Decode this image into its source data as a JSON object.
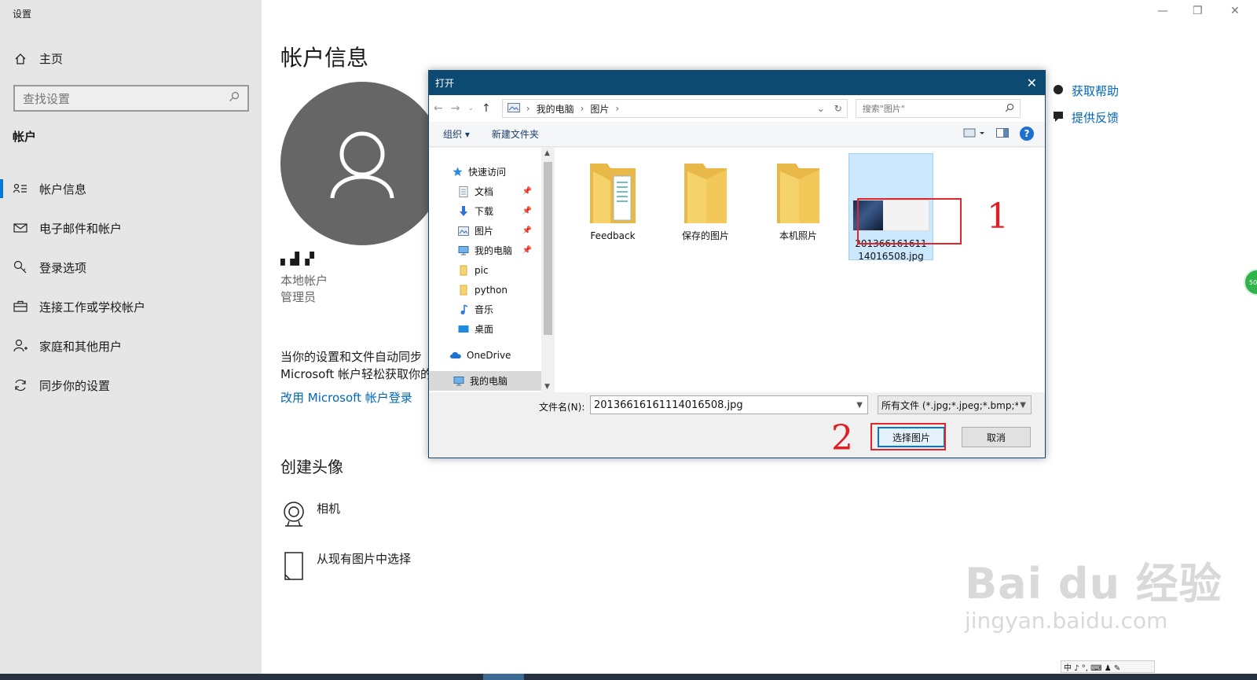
{
  "app": {
    "title": "设置",
    "window_controls": {
      "minimize": "—",
      "maximize": "❐",
      "close": "✕"
    }
  },
  "sidebar": {
    "home_label": "主页",
    "search_placeholder": "查找设置",
    "section_title": "帐户",
    "items": [
      {
        "label": "帐户信息",
        "icon": "account-info-icon",
        "active": true
      },
      {
        "label": "电子邮件和帐户",
        "icon": "mail-icon",
        "active": false
      },
      {
        "label": "登录选项",
        "icon": "key-icon",
        "active": false
      },
      {
        "label": "连接工作或学校帐户",
        "icon": "briefcase-icon",
        "active": false
      },
      {
        "label": "家庭和其他用户",
        "icon": "person-add-icon",
        "active": false
      },
      {
        "label": "同步你的设置",
        "icon": "sync-icon",
        "active": false
      }
    ]
  },
  "main": {
    "title": "帐户信息",
    "user_name": "▖▟ ▞",
    "account_type": "本地帐户",
    "account_role": "管理员",
    "sync_text_line1": "当你的设置和文件自动同步",
    "sync_text_line2": "Microsoft 帐户轻松获取你的",
    "ms_login_link": "改用 Microsoft 帐户登录",
    "create_avatar_title": "创建头像",
    "camera_label": "相机",
    "browse_label": "从现有图片中选择",
    "help_links": [
      "获取帮助",
      "提供反馈"
    ]
  },
  "dialog": {
    "title": "打开",
    "close": "✕",
    "breadcrumb": [
      "我的电脑",
      "图片"
    ],
    "search_placeholder": "搜索\"图片\"",
    "toolbar": {
      "organize": "组织 ▾",
      "new_folder": "新建文件夹"
    },
    "nav_tree": [
      {
        "label": "快速访问",
        "icon": "star-icon",
        "indent": 0,
        "pinned": false,
        "selected": false
      },
      {
        "label": "文档",
        "icon": "document-icon",
        "indent": 1,
        "pinned": true,
        "selected": false
      },
      {
        "label": "下载",
        "icon": "download-icon",
        "indent": 1,
        "pinned": true,
        "selected": false
      },
      {
        "label": "图片",
        "icon": "pictures-icon",
        "indent": 1,
        "pinned": true,
        "selected": false
      },
      {
        "label": "我的电脑",
        "icon": "computer-icon",
        "indent": 1,
        "pinned": true,
        "selected": false
      },
      {
        "label": "pic",
        "icon": "folder-icon",
        "indent": 1,
        "pinned": false,
        "selected": false
      },
      {
        "label": "python",
        "icon": "folder-icon",
        "indent": 1,
        "pinned": false,
        "selected": false
      },
      {
        "label": "音乐",
        "icon": "music-icon",
        "indent": 1,
        "pinned": false,
        "selected": false
      },
      {
        "label": "桌面",
        "icon": "desktop-icon",
        "indent": 1,
        "pinned": false,
        "selected": false
      },
      {
        "label": "OneDrive",
        "icon": "cloud-icon",
        "indent": 0,
        "pinned": false,
        "selected": false
      },
      {
        "label": "我的电脑",
        "icon": "computer-icon",
        "indent": 0,
        "pinned": false,
        "selected": true
      }
    ],
    "files": [
      {
        "name": "Feedback",
        "type": "folder",
        "selected": false
      },
      {
        "name": "保存的图片",
        "type": "folder",
        "selected": false
      },
      {
        "name": "本机照片",
        "type": "folder",
        "selected": false
      },
      {
        "name": "201366161611\n14016508.jpg",
        "type": "image",
        "selected": true
      }
    ],
    "filename_label": "文件名(N):",
    "filename_value": "20136616161114016508.jpg",
    "filetype_value": "所有文件 (*.jpg;*.jpeg;*.bmp;*",
    "ok_button": "选择图片",
    "cancel_button": "取消"
  },
  "annotations": {
    "step1": "1",
    "step2": "2"
  },
  "watermark": {
    "line1": "Bai du 经验",
    "line2": "jingyan.baidu.com"
  },
  "badge_text": "50",
  "ime_text": "中 ♪ °, ⌨ ♟ ✎",
  "colors": {
    "accent": "#0078d7",
    "link": "#0067b8",
    "dialog_title": "#0d4a72",
    "annotation": "#e0262a",
    "sidebar_bg": "#e6e6e6"
  }
}
